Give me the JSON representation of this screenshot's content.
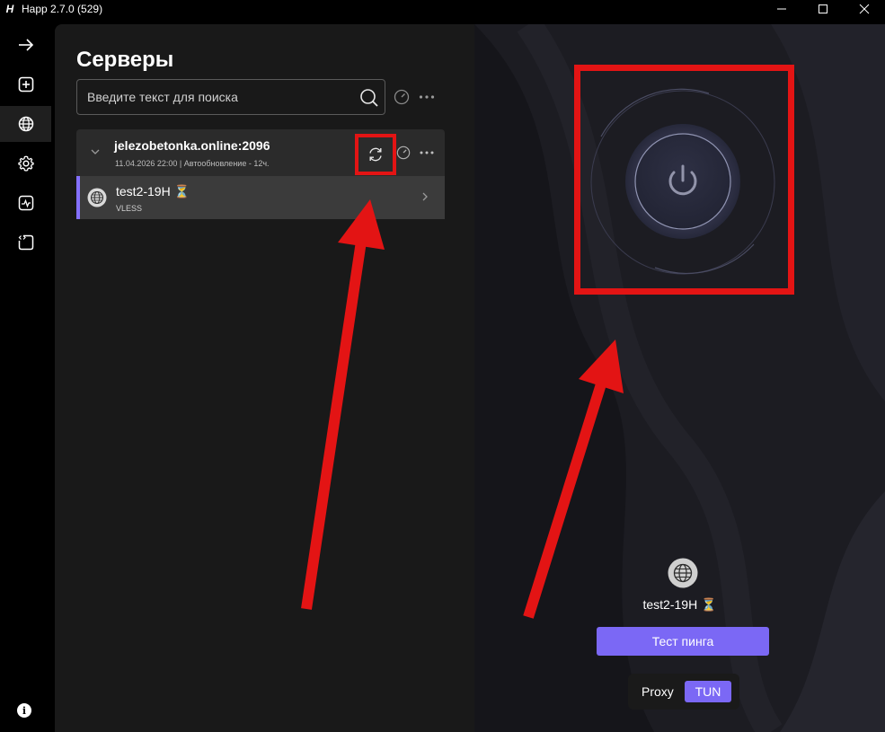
{
  "window": {
    "title": "Happ 2.7.0 (529)",
    "logo_letter": "H"
  },
  "sidebar": {
    "items": [
      {
        "icon": "arrow-right-icon"
      },
      {
        "icon": "add-square-icon"
      },
      {
        "icon": "globe-icon",
        "active": true
      },
      {
        "icon": "gear-icon"
      },
      {
        "icon": "activity-icon"
      },
      {
        "icon": "code-file-icon"
      }
    ],
    "info_label": "i"
  },
  "servers": {
    "title": "Серверы",
    "search_placeholder": "Введите текст для поиска",
    "group": {
      "name": "jelezobetonka.online:2096",
      "meta": "11.04.2026 22:00 | Автообновление - 12ч.",
      "servers": [
        {
          "name": "test2-19H ⏳",
          "protocol": "VLESS"
        }
      ]
    }
  },
  "connect": {
    "current_server": "test2-19H ⏳",
    "ping_button": "Тест пинга",
    "mode_proxy": "Proxy",
    "mode_tun": "TUN",
    "accent_color": "#7b68f5",
    "highlight_color": "#e31414"
  }
}
